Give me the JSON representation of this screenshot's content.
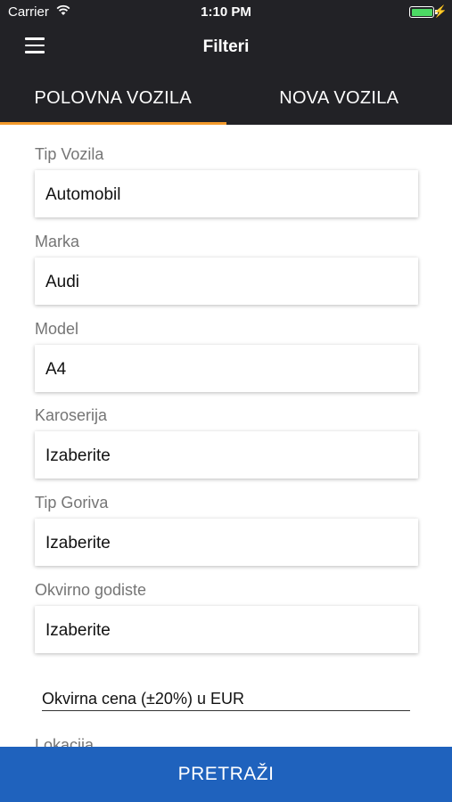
{
  "status_bar": {
    "carrier": "Carrier",
    "time": "1:10 PM",
    "battery_level": 1.0
  },
  "header": {
    "title": "Filteri",
    "menu_icon": "hamburger-menu-icon"
  },
  "tabs": [
    {
      "label": "POLOVNA VOZILA",
      "active": true
    },
    {
      "label": "NOVA VOZILA",
      "active": false
    }
  ],
  "fields": [
    {
      "label": "Tip Vozila",
      "value": "Automobil"
    },
    {
      "label": "Marka",
      "value": "Audi"
    },
    {
      "label": "Model",
      "value": "A4"
    },
    {
      "label": "Karoserija",
      "value": "Izaberite"
    },
    {
      "label": "Tip Goriva",
      "value": "Izaberite"
    },
    {
      "label": "Okvirno godiste",
      "value": "Izaberite"
    }
  ],
  "price_field": {
    "text": "Okvirna cena (±20%) u EUR"
  },
  "partial_field": {
    "label": "Lokacija"
  },
  "search_button": {
    "label": "PRETRAŽI"
  },
  "colors": {
    "bar_background": "#222226",
    "tab_indicator": "#f39a2b",
    "button_background": "#1f62bd"
  }
}
